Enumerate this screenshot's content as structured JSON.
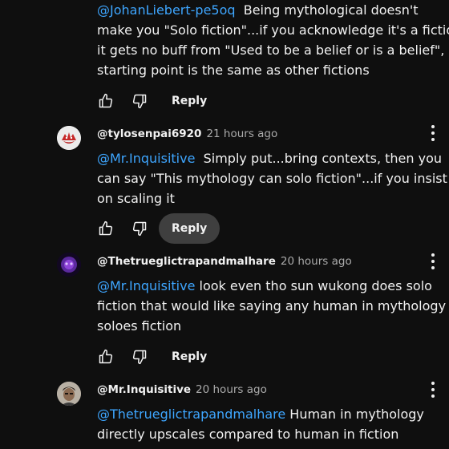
{
  "comments": [
    {
      "mention": "@JohanLiebert-pe5oq",
      "lines_after": [
        "Being mythological doesn't",
        "make you \"Solo fiction\"...if you acknowledge it's a fiction",
        "it gets no buff from \"Used to be a belief or is a belief\", its",
        "starting point is the same as other fictions"
      ],
      "reply_label": "Reply"
    },
    {
      "author": "@tylosenpai6920",
      "time": "21 hours ago",
      "mention": "@Mr.Inquisitive",
      "lines_after": [
        "Simply put...bring contexts, then you",
        "can say \"This mythology can solo fiction\"...if you insist",
        "on scaling it"
      ],
      "reply_label": "Reply"
    },
    {
      "author": "@Thetrueglictrapandmalhare",
      "time": "20 hours ago",
      "mention": "@Mr.Inquisitive",
      "lines_after": [
        "look even tho sun wukong does solo",
        "fiction that would like saying any human in mythology",
        "soloes fiction"
      ],
      "reply_label": "Reply"
    },
    {
      "author": "@Mr.Inquisitive",
      "time": "20 hours ago",
      "mention": "@Thetrueglictrapandmalhare",
      "lines_after": [
        "Human in mythology",
        "directly upscales compared to human in fiction"
      ]
    }
  ],
  "icons": {
    "like": "thumbs-up-icon",
    "dislike": "thumbs-down-icon",
    "menu": "more-vert-icon"
  },
  "colors": {
    "background": "#0f0f0f",
    "mention": "#3ea6ff",
    "text": "#f1f1f1",
    "secondary_text": "#aaaaaa",
    "reply_hover": "#3f3f3f"
  }
}
